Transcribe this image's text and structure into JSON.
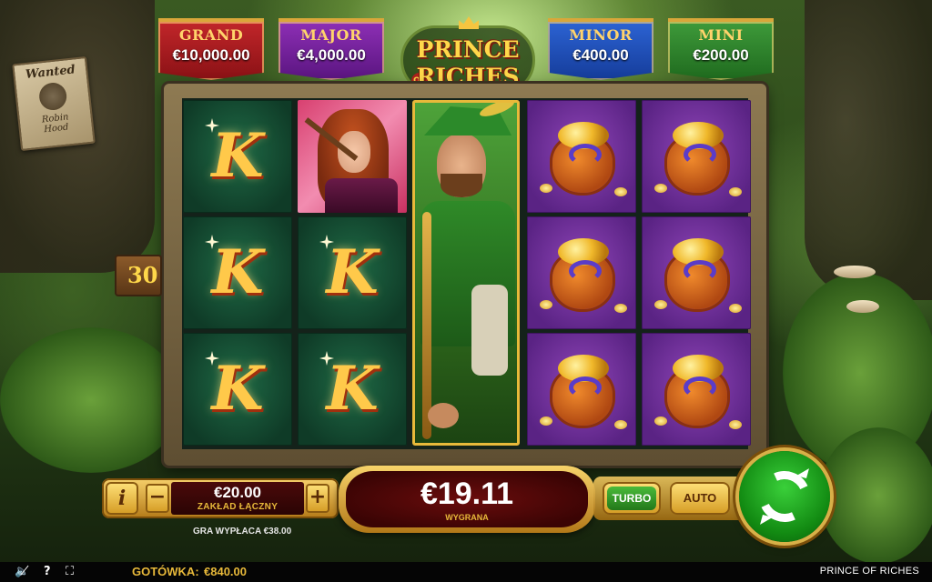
{
  "jackpots": {
    "grand": {
      "name": "GRAND",
      "value": "€10,000.00"
    },
    "major": {
      "name": "MAJOR",
      "value": "€4,000.00"
    },
    "minor": {
      "name": "MINOR",
      "value": "€400.00"
    },
    "mini": {
      "name": "MINI",
      "value": "€200.00"
    }
  },
  "logo": {
    "line1": "PRINCE",
    "of": "OF",
    "line2": "RICHES"
  },
  "wanted_poster": {
    "title": "Wanted",
    "name_line1": "Robin",
    "name_line2": "Hood"
  },
  "side_counter": "30",
  "reels": {
    "symbol_k": "K",
    "grid": [
      [
        "K",
        "archer",
        "hero",
        "pot",
        "pot"
      ],
      [
        "K",
        "K",
        "hero",
        "pot",
        "pot"
      ],
      [
        "K",
        "K",
        "hero",
        "pot",
        "pot"
      ]
    ]
  },
  "bet": {
    "value": "€20.00",
    "label": "ZAKŁAD ŁĄCZNY",
    "minus": "−",
    "plus": "+",
    "info": "i"
  },
  "payout_text": "GRA WYPŁACA €38.00",
  "win": {
    "value": "€19.11",
    "label": "WYGRANA"
  },
  "buttons": {
    "turbo": "TURBO",
    "auto": "AUTO"
  },
  "status_bar": {
    "sound_icon": "🔈̸",
    "help_icon": "?",
    "fullscreen_icon": "⛶",
    "balance_label": "GOTÓWKA:",
    "balance_value": "€840.00",
    "game_name": "PRINCE OF RICHES"
  }
}
